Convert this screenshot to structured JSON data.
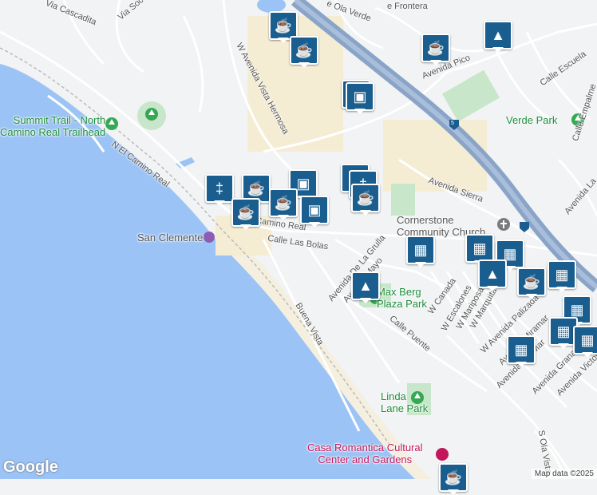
{
  "map": {
    "colors": {
      "water": "#9cc3f5",
      "land": "#f1f3f4",
      "road": "#ffffff",
      "highway": "#8aa4c8",
      "park": "#c8e6c9",
      "commercial": "#f5ecd4",
      "marker": "#1a5d8f"
    },
    "labels": {
      "via_cascadita": "Via Cascadita",
      "via_soc": "Via Soc",
      "ola_verde": "e Ola Verde",
      "frontera": "e Frontera",
      "avenida_pico": "Avenida Pico",
      "calle_escuela": "Calle Escuela",
      "vista_hermosa": "W Avenida Vista Hermosa",
      "el_camino_north": "N El Camino Real",
      "summit_trail": "Summit Trail - North\nCamino Real Trailhead",
      "calle_empalme": "Calle Empalme",
      "verde_park": "Verde Park",
      "avenida_sierra": "Avenida Sierra",
      "avenida_la": "Avenida La",
      "cornerstone": "Cornerstone\nCommunity Church",
      "san_clemente": "San Clemente",
      "camino_real": "Camino Real",
      "calle_las_bolas": "Calle Las Bolas",
      "de_la_grulla": "Avenida De La Grulla",
      "avenida_mayo": "Avenida Mayo",
      "max_berg": "Max Berg\nPlaza Park",
      "buena_vista": "Buena Vista",
      "w_canada": "W Canada",
      "w_escalones": "W Escalones",
      "w_mariposa": "W Mariposa",
      "w_marquita": "W Marquita",
      "palizada": "W Avenida Palizada",
      "miramar": "Avenida Miramar",
      "calle_puente": "Calle Puente",
      "avenida_del_mar": "Avenida Del Mar",
      "avenida_grana": "Avenida Grana",
      "avenida_victoria": "Avenida Victoria",
      "ola_vista": "S Ola Vista",
      "linda_lane": "Linda\nLane Park",
      "casa_romantica": "Casa Romantica Cultural\nCenter and Gardens",
      "i5": "5"
    },
    "markers": [
      {
        "icon": "coffee-icon"
      },
      {
        "icon": "coffee-icon"
      },
      {
        "icon": "coffee-icon"
      },
      {
        "icon": "school-icon"
      },
      {
        "icon": "restaurant-icon"
      },
      {
        "icon": "shopping-bag-icon"
      },
      {
        "icon": "shopping-bag-icon"
      },
      {
        "icon": "restaurant-icon"
      },
      {
        "icon": "coffee-icon"
      },
      {
        "icon": "restaurant-icon"
      },
      {
        "icon": "restaurant-icon"
      },
      {
        "icon": "coffee-icon"
      },
      {
        "icon": "coffee-icon"
      },
      {
        "icon": "shopping-bag-icon"
      },
      {
        "icon": "coffee-icon"
      },
      {
        "icon": "shopping-cart-icon"
      },
      {
        "icon": "shopping-cart-icon"
      },
      {
        "icon": "shopping-cart-icon"
      },
      {
        "icon": "school-icon"
      },
      {
        "icon": "school-icon"
      },
      {
        "icon": "coffee-icon"
      },
      {
        "icon": "shopping-cart-icon"
      },
      {
        "icon": "shopping-cart-icon"
      },
      {
        "icon": "shopping-cart-icon"
      },
      {
        "icon": "shopping-cart-icon"
      },
      {
        "icon": "shopping-cart-icon"
      },
      {
        "icon": "coffee-icon"
      }
    ]
  },
  "branding": {
    "logo": "Google",
    "attribution": "Map data ©2025"
  }
}
